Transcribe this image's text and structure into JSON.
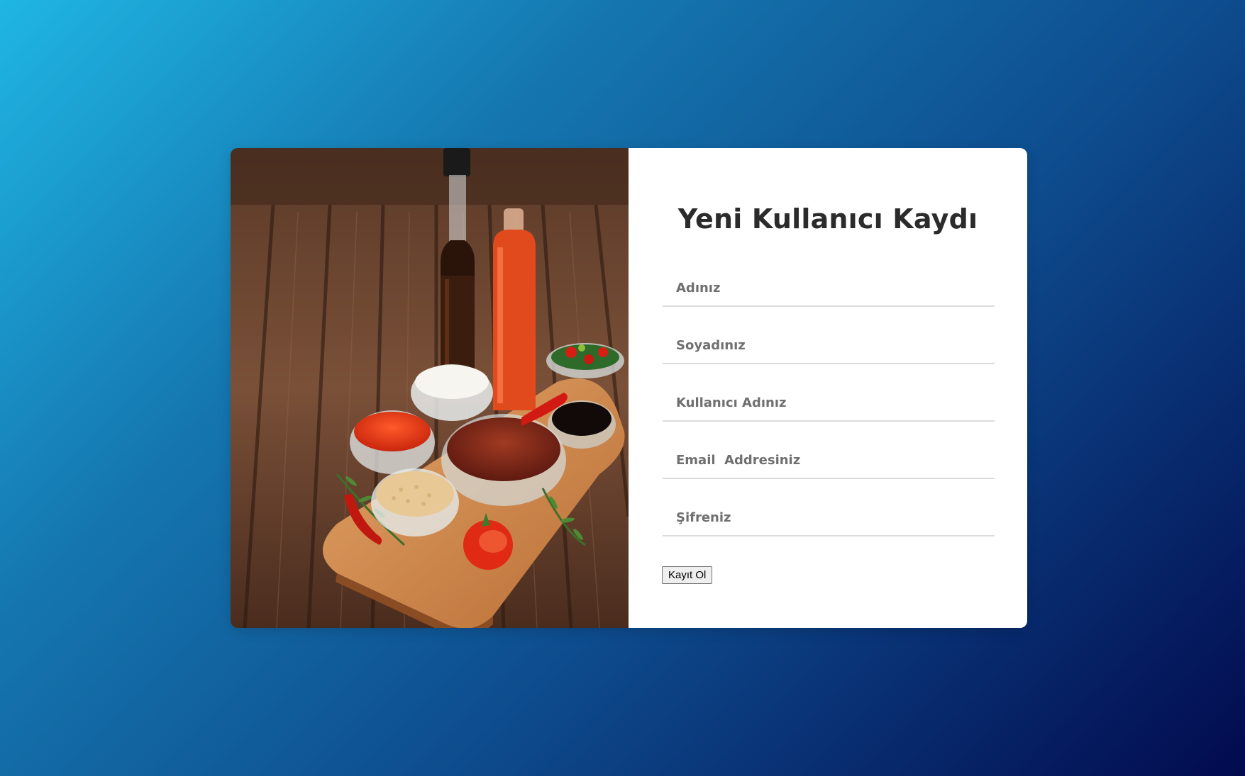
{
  "form": {
    "title": "Yeni Kullanıcı Kaydı",
    "fields": [
      {
        "placeholder": "Adınız",
        "value": ""
      },
      {
        "placeholder": "Soyadınız",
        "value": ""
      },
      {
        "placeholder": "Kullanıcı Adınız",
        "value": ""
      },
      {
        "placeholder": "Email  Addresiniz",
        "value": ""
      },
      {
        "placeholder": "Şifreniz",
        "value": ""
      }
    ],
    "submit_label": "Kayıt Ol"
  },
  "image": {
    "subject": "sauces-on-wooden-board"
  },
  "colors": {
    "background_start": "#1fb6e4",
    "background_end": "#020a4e",
    "card": "#ffffff",
    "title_text": "#2b2b2b",
    "field_underline": "#dcdcdc"
  }
}
